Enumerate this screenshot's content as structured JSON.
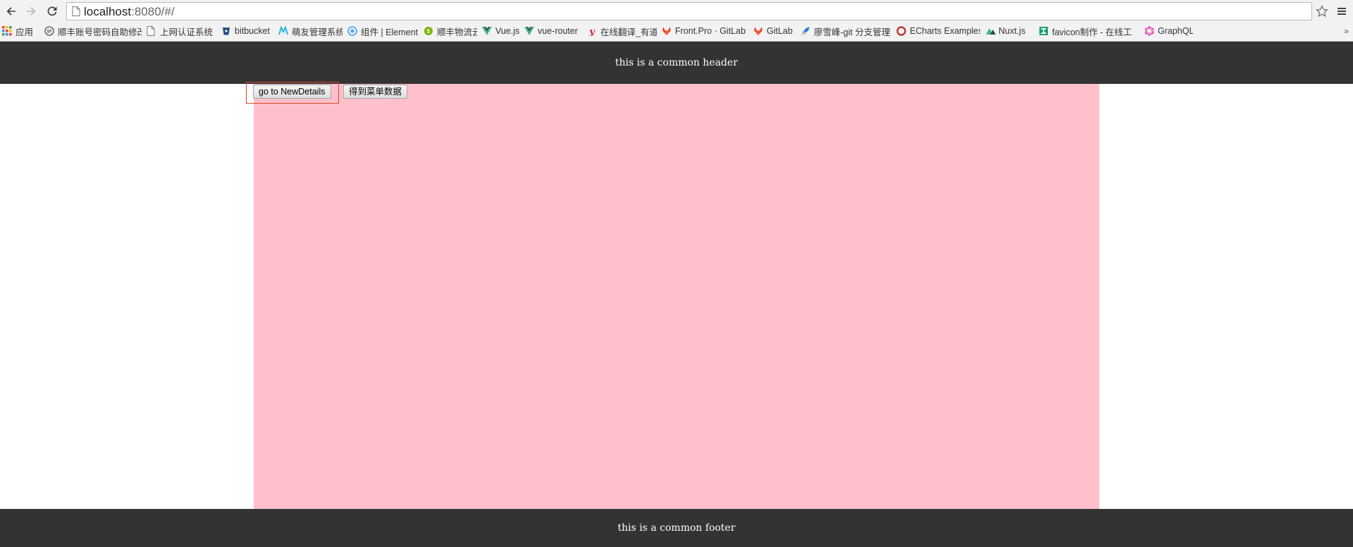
{
  "browser": {
    "url_host": "localhost",
    "url_rest": ":8080/#/",
    "icons": {
      "back": "arrow-left-icon",
      "forward": "arrow-right-icon",
      "reload": "reload-icon",
      "page": "page-icon",
      "star": "star-icon",
      "menu": "hamburger-menu-icon"
    },
    "bookmarks": [
      {
        "label": "应用",
        "icon": "apps-grid-icon",
        "color": "#4285f4"
      },
      {
        "label": "顺丰账号密码自助修改",
        "icon": "sf-icon",
        "color": "#555555"
      },
      {
        "label": "上网认证系统",
        "icon": "page-icon",
        "color": "#777777"
      },
      {
        "label": "bitbucket",
        "icon": "bitbucket-icon",
        "color": "#205081"
      },
      {
        "label": "萌友管理系统",
        "icon": "m-logo-icon",
        "color": "#1fb8d8"
      },
      {
        "label": "组件 | Element",
        "icon": "element-icon",
        "color": "#409eff"
      },
      {
        "label": "顺丰物流云",
        "icon": "sf-cloud-icon",
        "color": "#7cb305"
      },
      {
        "label": "Vue.js",
        "icon": "vue-icon",
        "color": "#42b883"
      },
      {
        "label": "vue-router",
        "icon": "vue-icon",
        "color": "#42b883"
      },
      {
        "label": "在线翻译_有道",
        "icon": "youdao-icon",
        "color": "#e02020"
      },
      {
        "label": "Front.Pro · GitLab",
        "icon": "gitlab-icon",
        "color": "#e24329"
      },
      {
        "label": "GitLab",
        "icon": "gitlab-icon",
        "color": "#e24329"
      },
      {
        "label": "廖雪峰-git 分支管理",
        "icon": "rocket-icon",
        "color": "#2f7bd6"
      },
      {
        "label": "ECharts Examples",
        "icon": "echarts-icon",
        "color": "#c23531"
      },
      {
        "label": "Nuxt.js",
        "icon": "nuxt-icon",
        "color": "#2e495e"
      },
      {
        "label": "favicon制作 - 在线工",
        "icon": "favicon-tool-icon",
        "color": "#1a9e6b"
      },
      {
        "label": "GraphQL",
        "icon": "graphql-icon",
        "color": "#e535ab"
      }
    ],
    "overflow": "»"
  },
  "app": {
    "header_text": "this is a common header",
    "footer_text": "this is a common footer",
    "buttons": {
      "go_new_details": "go to NewDetails",
      "get_menu_data": "得到菜单数据"
    },
    "colors": {
      "header_bg": "#333333",
      "content_bg": "#ffc0cb",
      "focus_outline": "#d24a2b"
    }
  }
}
